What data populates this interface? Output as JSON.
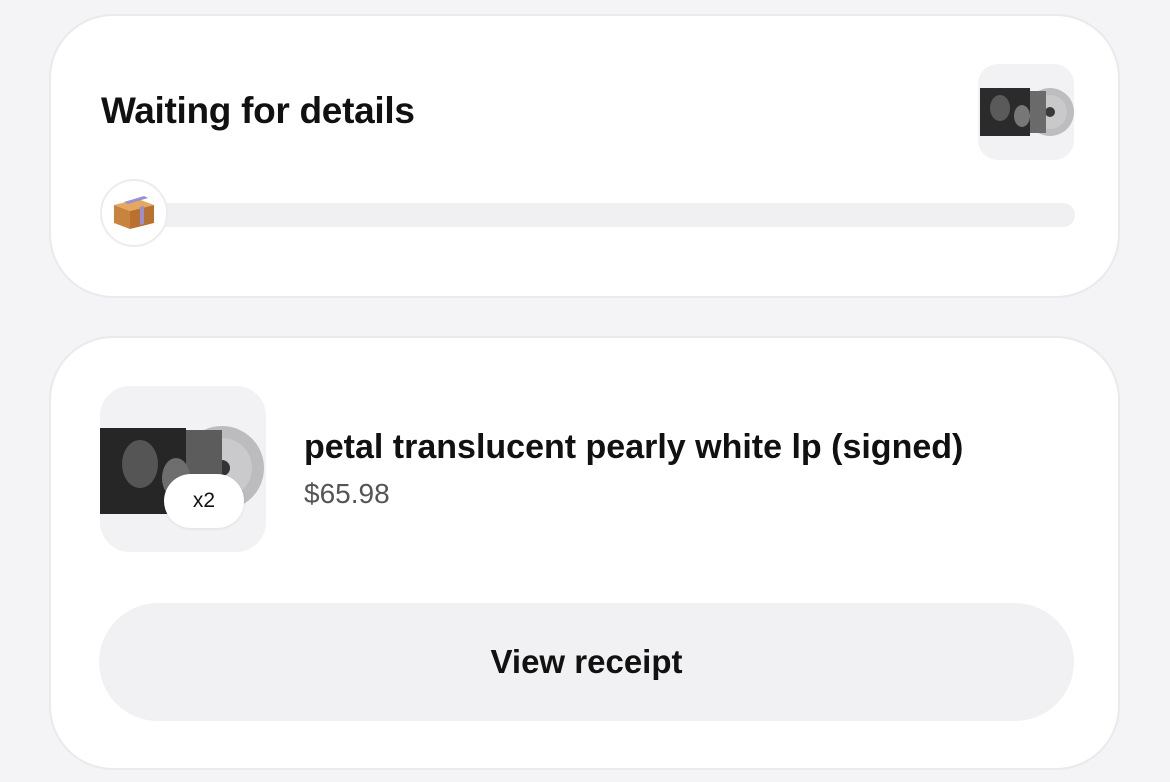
{
  "status": {
    "title": "Waiting for details",
    "progress": 0.0,
    "progress_icon": "package-icon",
    "thumbnail_icon": "album-cover-icon"
  },
  "item": {
    "title": "petal translucent pearly white lp (signed)",
    "price": "$65.98",
    "quantity_label": "x2",
    "thumbnail_icon": "album-cover-icon"
  },
  "actions": {
    "view_receipt_label": "View receipt"
  },
  "colors": {
    "card_bg": "#ffffff",
    "page_bg": "#f4f4f6",
    "button_bg": "#f1f1f3",
    "track_bg": "#f0f0f3"
  }
}
